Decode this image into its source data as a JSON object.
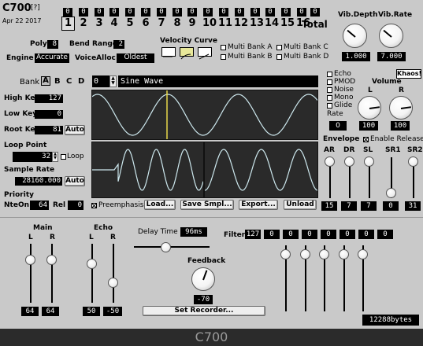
{
  "header": {
    "app_name": "C700",
    "help_label": "[?]",
    "date": "Apr 22 2017",
    "top_values": [
      "0",
      "0",
      "0",
      "0",
      "0",
      "0",
      "0",
      "0",
      "0",
      "0",
      "0",
      "0",
      "0",
      "0",
      "0",
      "0"
    ],
    "total_value": "0",
    "channels": [
      "1",
      "2",
      "3",
      "4",
      "5",
      "6",
      "7",
      "8",
      "9",
      "10",
      "11",
      "12",
      "13",
      "14",
      "15",
      "16"
    ],
    "total_label": "Total"
  },
  "global": {
    "poly_label": "Poly",
    "poly_value": "8",
    "bend_label": "Bend Range",
    "bend_value": "2",
    "engine_label": "Engine",
    "engine_value": "Accurate",
    "voicealloc_label": "VoiceAlloc",
    "voicealloc_value": "Oldest",
    "velocity_label": "Velocity Curve",
    "multibank": [
      "Multi Bank A",
      "Multi Bank B",
      "Multi Bank C",
      "Multi Bank D"
    ],
    "vib_depth_label": "Vib.Depth",
    "vib_rate_label": "Vib.Rate",
    "vib_depth_value": "1.000",
    "vib_rate_value": "7.000"
  },
  "program": {
    "bank_label": "Bank",
    "banks": [
      "A",
      "B",
      "C",
      "D"
    ],
    "program_number": "0",
    "program_name": "Sine Wave",
    "high_key_label": "High Key",
    "high_key_value": "127",
    "low_key_label": "Low Key",
    "low_key_value": "0",
    "root_key_label": "Root Key",
    "root_key_value": "81",
    "auto_label": "Auto",
    "loop_point_label": "Loop Point",
    "loop_point_value": "32",
    "loop_label": "Loop",
    "sample_rate_label": "Sample Rate",
    "sample_rate_value": "28160.000",
    "priority_label": "Priority",
    "nteon_label": "NteOn",
    "nteon_value": "64",
    "rel_label": "Rel",
    "rel_value": "0",
    "preemphasis_label": "Preemphasis",
    "load_label": "Load...",
    "save_label": "Save Smpl...",
    "export_label": "Export...",
    "unload_label": "Unload"
  },
  "voice": {
    "echo_label": "Echo",
    "pmod_label": "PMOD",
    "noise_label": "Noise",
    "mono_label": "Mono",
    "glide_label": "Glide",
    "rate_label": "Rate",
    "rate_value": "0",
    "khaos_label": "Khaos!",
    "volume_label": "Volume",
    "vol_l_label": "L",
    "vol_r_label": "R",
    "vol_l_value": "100",
    "vol_r_value": "100",
    "envelope_label": "Envelope",
    "enable_release_label": "Enable Release",
    "env_labels": [
      "AR",
      "DR",
      "SL",
      "SR1",
      "SR2"
    ],
    "env_values": [
      "15",
      "7",
      "7",
      "0",
      "31"
    ],
    "env_levels": [
      1.0,
      1.0,
      1.0,
      0.0,
      1.0
    ]
  },
  "mixer": {
    "main_label": "Main",
    "main_l_label": "L",
    "main_r_label": "R",
    "main_l_value": "64",
    "main_r_value": "64",
    "echo_label": "Echo",
    "echo_l_label": "L",
    "echo_r_label": "R",
    "echo_l_value": "50",
    "echo_r_value": "-50",
    "delay_label": "Delay Time",
    "delay_value": "96ms",
    "feedback_label": "Feedback",
    "feedback_value": "-70",
    "filter_label": "Filter",
    "filter_values": [
      "127",
      "0",
      "0",
      "0",
      "0",
      "0",
      "0",
      "0"
    ],
    "set_recorder_label": "Set Recorder...",
    "memory_value": "12288bytes"
  },
  "footer": {
    "title": "C700"
  },
  "colors": {
    "background": "#c9c9c9",
    "scope": "#2a2a2a",
    "wave": "#cde8ee",
    "cursor": "#e8d84a"
  }
}
